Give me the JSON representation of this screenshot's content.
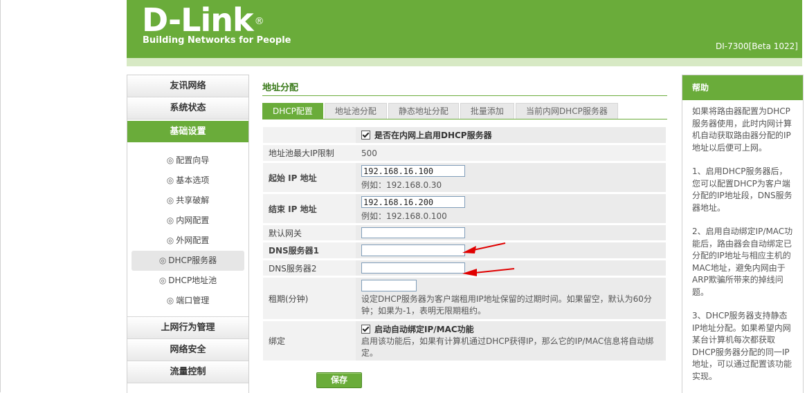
{
  "header": {
    "logo": "D-Link",
    "logo_mark": "®",
    "tagline": "Building Networks for People",
    "model": "DI-7300[Beta 1022]"
  },
  "sidebar": {
    "top_items": [
      "友讯网络",
      "系统状态"
    ],
    "active_section": "基础设置",
    "sub_items": [
      {
        "label": "配置向导",
        "active": false
      },
      {
        "label": "基本选项",
        "active": false
      },
      {
        "label": "共享破解",
        "active": false
      },
      {
        "label": "内网配置",
        "active": false
      },
      {
        "label": "外网配置",
        "active": false
      },
      {
        "label": "DHCP服务器",
        "active": true
      },
      {
        "label": "DHCP地址池",
        "active": false
      },
      {
        "label": "端口管理",
        "active": false
      }
    ],
    "sub_icon": "◎",
    "bottom_items": [
      "上网行为管理",
      "网络安全",
      "流量控制"
    ]
  },
  "main": {
    "title": "地址分配",
    "tabs": [
      "DHCP配置",
      "地址池分配",
      "静态地址分配",
      "批量添加",
      "当前内网DHCP服务器"
    ],
    "active_tab": 0,
    "form": {
      "enable_dhcp_label": "是否在内网上启用DHCP服务器",
      "enable_dhcp_checked": true,
      "pool_max_label": "地址池最大IP限制",
      "pool_max_value": "500",
      "start_ip_label": "起始 IP 地址",
      "start_ip_value": "192.168.16.100",
      "start_ip_hint": "例如：192.168.0.30",
      "end_ip_label": "结束 IP 地址",
      "end_ip_value": "192.168.16.200",
      "end_ip_hint": "例如：192.168.0.100",
      "gateway_label": "默认网关",
      "gateway_value": "",
      "dns1_label": "DNS服务器1",
      "dns1_value": "",
      "dns2_label": "DNS服务器2",
      "dns2_value": "",
      "lease_label": "租期(分钟)",
      "lease_value": "",
      "lease_hint": "设定DHCP服务器为客户端租用IP地址保留的过期时间。如果留空，默认为60分钟；如果为-1，表明无限期租约。",
      "bind_label": "绑定",
      "bind_check_label": "启动自动绑定IP/MAC功能",
      "bind_checked": true,
      "bind_hint": "启用该功能后，如果有计算机通过DHCP获得IP，那么它的IP/MAC信息将自动绑定。"
    },
    "save_label": "保存"
  },
  "help": {
    "title": "帮助",
    "paragraphs": [
      "如果将路由器配置为DHCP服务器使用，此时内网计算机自动获取路由器分配的IP地址以后便可上网。",
      "1、启用DHCP服务器后，您可以配置DHCP为客户端分配的IP地址段，DNS服务器地址。",
      "2、启用自动绑定IP/MAC功能后，路由器会自动绑定已分配的IP地址与相应主机的MAC地址，避免内网由于ARP欺骗所带来的掉线问题。",
      "3、DHCP服务器支持静态IP地址分配。如果希望内网某台计算机每次都获取DHCP服务器分配的同一IP地址，可以通过配置该功能实现。"
    ]
  },
  "colors": {
    "brand_green": "#6aac3a",
    "annotation_red": "#e00000"
  }
}
